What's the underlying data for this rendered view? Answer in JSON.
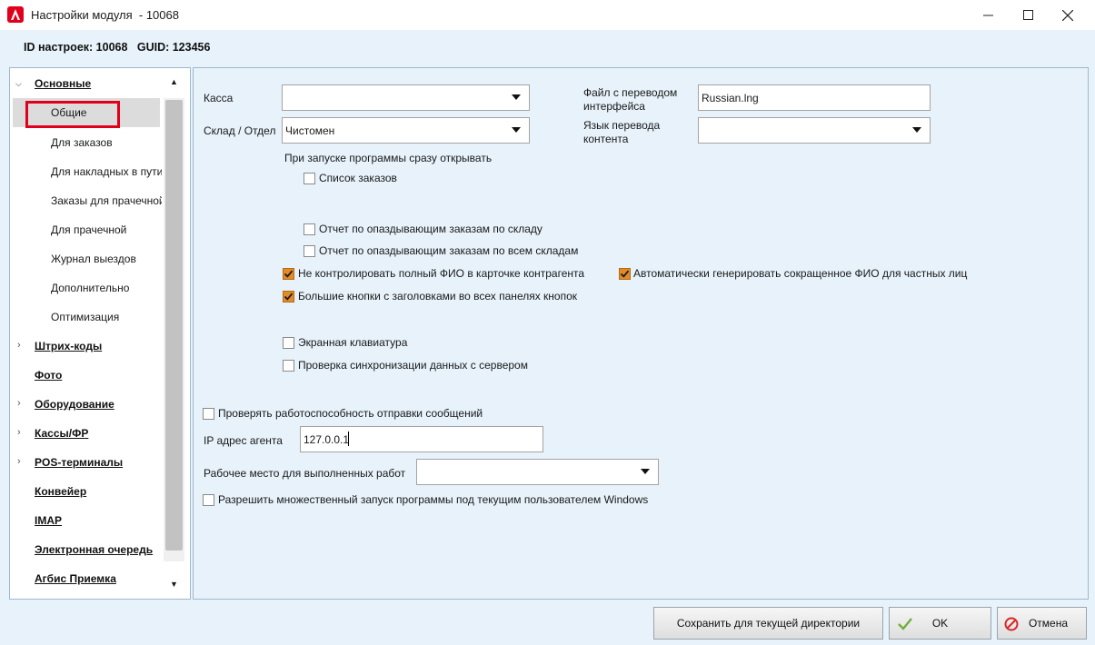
{
  "window": {
    "title": "Настройки модуля  - 10068",
    "logo_letter": "A",
    "accent": "#e0001b"
  },
  "header": {
    "id_label": "ID настроек: 10068   GUID: 123456"
  },
  "tree": {
    "groups": [
      {
        "label": "Основные",
        "expanded": true
      },
      {
        "label": "Штрих-коды"
      },
      {
        "label": "Фото"
      },
      {
        "label": "Оборудование"
      },
      {
        "label": "Кассы/ФР"
      },
      {
        "label": "POS-терминалы"
      },
      {
        "label": "Конвейер"
      },
      {
        "label": "IMAP"
      },
      {
        "label": "Электронная очередь"
      },
      {
        "label": "Агбис Приемка"
      }
    ],
    "items": [
      {
        "label": "Общие",
        "selected": true
      },
      {
        "label": "Для заказов"
      },
      {
        "label": "Для накладных в пути"
      },
      {
        "label": "Заказы для прачечной"
      },
      {
        "label": "Для прачечной"
      },
      {
        "label": "Журнал выездов"
      },
      {
        "label": "Дополнительно"
      },
      {
        "label": "Оптимизация"
      }
    ]
  },
  "form": {
    "kassa_label": "Касса",
    "kassa_value": "",
    "sklad_label": "Склад / Отдел",
    "sklad_value": "Чистомен",
    "translation_file_label_1": "Файл с переводом",
    "translation_file_label_2": "интерфейса",
    "translation_file_value": "Russian.lng",
    "content_lang_label_1": "Язык перевода",
    "content_lang_label_2": "контента",
    "content_lang_value": "",
    "startup_label": "При запуске программы сразу открывать",
    "startup_orders": {
      "label": "Список заказов",
      "checked": false
    },
    "late_warehouse": {
      "label": "Отчет по опаздывающим заказам по складу",
      "checked": false
    },
    "late_all": {
      "label": "Отчет по опаздывающим заказам по всем складам",
      "checked": false
    },
    "no_full_fio": {
      "label": "Не контролировать полный ФИО в карточке контрагента",
      "checked": true
    },
    "auto_short_fio": {
      "label": "Автоматически генерировать сокращенное ФИО для частных лиц",
      "checked": true
    },
    "big_buttons": {
      "label": "Большие кнопки с заголовками во всех панелях кнопок",
      "checked": true
    },
    "screen_keyboard": {
      "label": "Экранная клавиатура",
      "checked": false
    },
    "sync_check": {
      "label": "Проверка синхронизации данных с сервером",
      "checked": false
    },
    "check_messages": {
      "label": "Проверять работоспособность отправки сообщений",
      "checked": false
    },
    "ip_label": "IP адрес агента",
    "ip_value": "127.0.0.1",
    "workplace_label": "Рабочее место для выполненных работ",
    "workplace_value": "",
    "multi_launch": {
      "label": "Разрешить множественный запуск программы под текущим пользователем Windows",
      "checked": false
    }
  },
  "buttons": {
    "save_dir": "Сохранить для текущей директории",
    "ok": "OK",
    "cancel": "Отмена"
  },
  "colors": {
    "check_on": "#e08a2a",
    "ok_icon": "#6fae3a",
    "cancel_icon": "#d9262b",
    "background": "#e7f2fa"
  }
}
